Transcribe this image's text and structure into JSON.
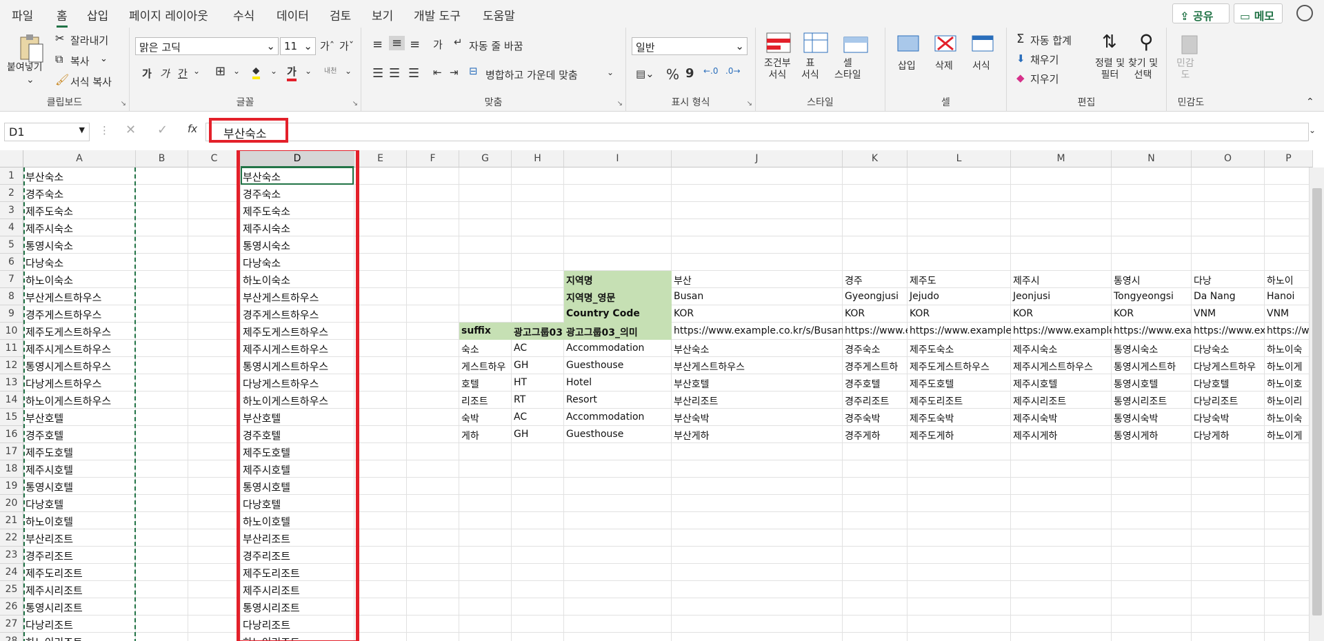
{
  "menu": {
    "file": "파일",
    "home": "홈",
    "insert": "삽입",
    "layout": "페이지 레이아웃",
    "formulas": "수식",
    "data": "데이터",
    "review": "검토",
    "view": "보기",
    "developer": "개발 도구",
    "help": "도움말",
    "share": "공유",
    "memo": "메모"
  },
  "ribbon": {
    "clipboard": {
      "paste": "붙여넣기",
      "cut": "잘라내기",
      "copy": "복사",
      "format_painter": "서식 복사",
      "label": "클립보드"
    },
    "font": {
      "name": "맑은 고딕",
      "size": "11",
      "label": "글꼴",
      "bold": "가",
      "italic": "가",
      "underline": "간",
      "strike": "내천"
    },
    "align": {
      "wrap": "자동 줄 바꿈",
      "merge": "병합하고 가운데 맞춤",
      "label": "맞춤",
      "orient": "가"
    },
    "number": {
      "format": "일반",
      "label": "표시 형식",
      "percent": "%",
      "comma": "9"
    },
    "styles": {
      "cond": "조건부\n서식",
      "table": "표\n서식",
      "cell": "셀\n스타일",
      "label": "스타일"
    },
    "cells": {
      "insert": "삽입",
      "delete": "삭제",
      "format": "서식",
      "label": "셀"
    },
    "edit": {
      "autosum": "자동 합계",
      "fill": "채우기",
      "clear": "지우기",
      "sort": "정렬 및\n필터",
      "find": "찾기 및\n선택",
      "label": "편집"
    },
    "sensitivity": {
      "btn": "민감\n도",
      "label": "민감도"
    }
  },
  "formula": {
    "namebox": "D1",
    "value": "부산숙소",
    "fx": "fx"
  },
  "columns": [
    "A",
    "B",
    "C",
    "D",
    "E",
    "F",
    "G",
    "H",
    "I",
    "J",
    "K",
    "L",
    "M",
    "N",
    "O",
    "P"
  ],
  "rows": [
    "1",
    "2",
    "3",
    "4",
    "5",
    "6",
    "7",
    "8",
    "9",
    "10",
    "11",
    "12",
    "13",
    "14",
    "15",
    "16",
    "17",
    "18",
    "19",
    "20",
    "21",
    "22",
    "23",
    "24",
    "25",
    "26",
    "27",
    "28"
  ],
  "colA": [
    "부산숙소",
    "경주숙소",
    "제주도숙소",
    "제주시숙소",
    "통영시숙소",
    "다낭숙소",
    "하노이숙소",
    "부산게스트하우스",
    "경주게스트하우스",
    "제주도게스트하우스",
    "제주시게스트하우스",
    "통영시게스트하우스",
    "다낭게스트하우스",
    "하노이게스트하우스",
    "부산호텔",
    "경주호텔",
    "제주도호텔",
    "제주시호텔",
    "통영시호텔",
    "다낭호텔",
    "하노이호텔",
    "부산리조트",
    "경주리조트",
    "제주도리조트",
    "제주시리조트",
    "통영시리조트",
    "다낭리조트",
    "하노이리조트"
  ],
  "colD": [
    "부산숙소",
    "경주숙소",
    "제주도숙소",
    "제주시숙소",
    "통영시숙소",
    "다낭숙소",
    "하노이숙소",
    "부산게스트하우스",
    "경주게스트하우스",
    "제주도게스트하우스",
    "제주시게스트하우스",
    "통영시게스트하우스",
    "다낭게스트하우스",
    "하노이게스트하우스",
    "부산호텔",
    "경주호텔",
    "제주도호텔",
    "제주시호텔",
    "통영시호텔",
    "다낭호텔",
    "하노이호텔",
    "부산리조트",
    "경주리조트",
    "제주도리조트",
    "제주시리조트",
    "통영시리조트",
    "다낭리조트",
    "하노이리조트"
  ],
  "table": {
    "row7": {
      "I": "지역명",
      "J": "부산",
      "K": "경주",
      "L": "제주도",
      "M": "제주시",
      "N": "통영시",
      "O": "다낭",
      "P": "하노이"
    },
    "row8": {
      "I": "지역명_영문",
      "J": "Busan",
      "K": "Gyeongjusi",
      "L": "Jejudo",
      "M": "Jeonjusi",
      "N": "Tongyeongsi",
      "O": "Da Nang",
      "P": "Hanoi"
    },
    "row9": {
      "I": "Country Code",
      "J": "KOR",
      "K": "KOR",
      "L": "KOR",
      "M": "KOR",
      "N": "KOR",
      "O": "VNM",
      "P": "VNM"
    },
    "row10": {
      "G": "suffix",
      "H": "광고그룹03",
      "I": "광고그룹03_의미",
      "J": "https://www.example.co.kr/s/Busan",
      "K": "https://www.ex",
      "L": "https://www.example.co",
      "M": "https://www.example.c",
      "N": "https://www.exam",
      "O": "https://www.exa",
      "P": "https://ww"
    },
    "row11": {
      "G": "숙소",
      "H": "AC",
      "I": "Accommodation",
      "J": "부산숙소",
      "K": "경주숙소",
      "L": "제주도숙소",
      "M": "제주시숙소",
      "N": "통영시숙소",
      "O": "다낭숙소",
      "P": "하노이숙"
    },
    "row12": {
      "G": "게스트하우",
      "H": "GH",
      "I": "Guesthouse",
      "J": "부산게스트하우스",
      "K": "경주게스트하",
      "L": "제주도게스트하우스",
      "M": "제주시게스트하우스",
      "N": "통영시게스트하",
      "O": "다낭게스트하우",
      "P": "하노이게"
    },
    "row13": {
      "G": "호텔",
      "H": "HT",
      "I": "Hotel",
      "J": "부산호텔",
      "K": "경주호텔",
      "L": "제주도호텔",
      "M": "제주시호텔",
      "N": "통영시호텔",
      "O": "다낭호텔",
      "P": "하노이호"
    },
    "row14": {
      "G": "리조트",
      "H": "RT",
      "I": "Resort",
      "J": "부산리조트",
      "K": "경주리조트",
      "L": "제주도리조트",
      "M": "제주시리조트",
      "N": "통영시리조트",
      "O": "다낭리조트",
      "P": "하노이리"
    },
    "row15": {
      "G": "숙박",
      "H": "AC",
      "I": "Accommodation",
      "J": "부산숙박",
      "K": "경주숙박",
      "L": "제주도숙박",
      "M": "제주시숙박",
      "N": "통영시숙박",
      "O": "다낭숙박",
      "P": "하노이숙"
    },
    "row16": {
      "G": "게하",
      "H": "GH",
      "I": "Guesthouse",
      "J": "부산게하",
      "K": "경주게하",
      "L": "제주도게하",
      "M": "제주시게하",
      "N": "통영시게하",
      "O": "다낭게하",
      "P": "하노이게"
    }
  }
}
